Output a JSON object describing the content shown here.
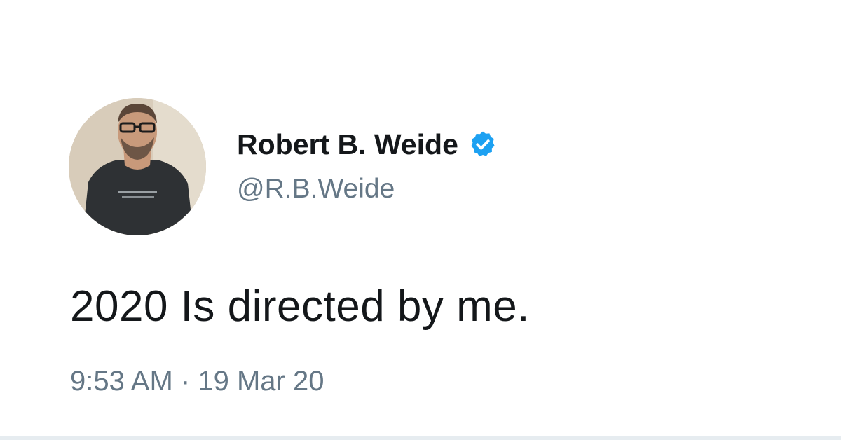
{
  "tweet": {
    "author": {
      "display_name": "Robert B. Weide",
      "handle": "@R.B.Weide",
      "verified": true,
      "avatar_icon": "profile-photo-avatar",
      "verified_icon": "verified-badge-icon"
    },
    "text": "2020 Is directed by me.",
    "time": "9:53 AM",
    "separator": "·",
    "date": "19 Mar 20"
  },
  "colors": {
    "name": "#14171a",
    "secondary": "#657786",
    "verified_blue": "#1da1f2",
    "background": "#ffffff"
  }
}
